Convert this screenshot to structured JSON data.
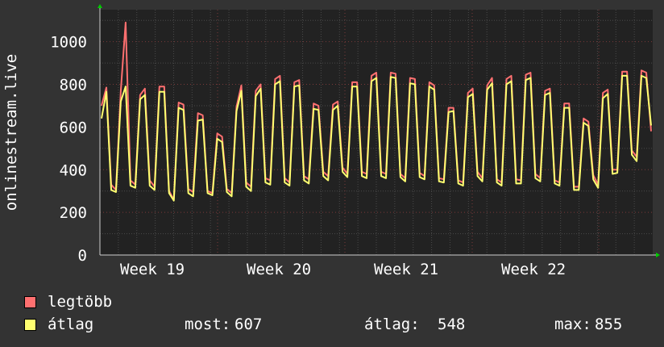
{
  "chart_data": {
    "type": "line",
    "ylabel": "onlinestream.live",
    "ylim": [
      0,
      1150
    ],
    "yticks": [
      0,
      200,
      400,
      600,
      800,
      1000
    ],
    "week_labels": [
      "Week 19",
      "Week 20",
      "Week 21",
      "Week 22"
    ],
    "series": [
      {
        "name": "legtöbb",
        "color": "#ff7070",
        "values": [
          700,
          785,
          330,
          305,
          770,
          1090,
          350,
          330,
          750,
          780,
          350,
          320,
          790,
          790,
          300,
          260,
          715,
          705,
          310,
          295,
          665,
          655,
          300,
          290,
          570,
          555,
          310,
          290,
          695,
          795,
          340,
          320,
          770,
          800,
          360,
          350,
          825,
          840,
          360,
          340,
          810,
          820,
          370,
          355,
          710,
          700,
          390,
          370,
          705,
          720,
          410,
          380,
          810,
          810,
          390,
          380,
          840,
          855,
          390,
          380,
          855,
          850,
          380,
          360,
          830,
          825,
          385,
          370,
          810,
          795,
          360,
          355,
          690,
          690,
          350,
          340,
          760,
          780,
          390,
          360,
          795,
          830,
          355,
          340,
          825,
          840,
          355,
          350,
          845,
          855,
          380,
          360,
          770,
          780,
          350,
          340,
          710,
          710,
          320,
          320,
          640,
          625,
          375,
          330,
          760,
          775,
          400,
          400,
          860,
          860,
          490,
          460,
          865,
          855,
          580
        ]
      },
      {
        "name": "átlag",
        "color": "#ffff70",
        "values": [
          640,
          765,
          305,
          295,
          720,
          790,
          325,
          315,
          730,
          750,
          325,
          305,
          765,
          765,
          290,
          255,
          690,
          680,
          290,
          275,
          630,
          635,
          290,
          280,
          545,
          530,
          295,
          275,
          675,
          770,
          320,
          300,
          745,
          780,
          340,
          330,
          800,
          815,
          340,
          325,
          790,
          795,
          350,
          335,
          685,
          680,
          370,
          350,
          680,
          700,
          390,
          365,
          790,
          790,
          370,
          360,
          815,
          830,
          370,
          360,
          835,
          830,
          365,
          345,
          805,
          800,
          365,
          355,
          790,
          775,
          345,
          340,
          670,
          675,
          335,
          325,
          740,
          755,
          370,
          345,
          775,
          805,
          340,
          325,
          800,
          815,
          335,
          335,
          820,
          830,
          360,
          345,
          750,
          760,
          335,
          325,
          690,
          690,
          305,
          305,
          620,
          605,
          355,
          315,
          735,
          755,
          380,
          385,
          840,
          840,
          470,
          440,
          840,
          830,
          607
        ]
      }
    ],
    "stats": {
      "most_label": "most:",
      "most_value": "607",
      "avg_label": "átlag:",
      "avg_value": "548",
      "max_label": "max:",
      "max_value": "855"
    },
    "colors": {
      "background": "#333333",
      "plot_bg": "#222222",
      "grid": "#4a4a4a",
      "week_grid": "#7a3a3a",
      "axis_arrow": "#00cc00",
      "text": "#ffffff"
    }
  }
}
